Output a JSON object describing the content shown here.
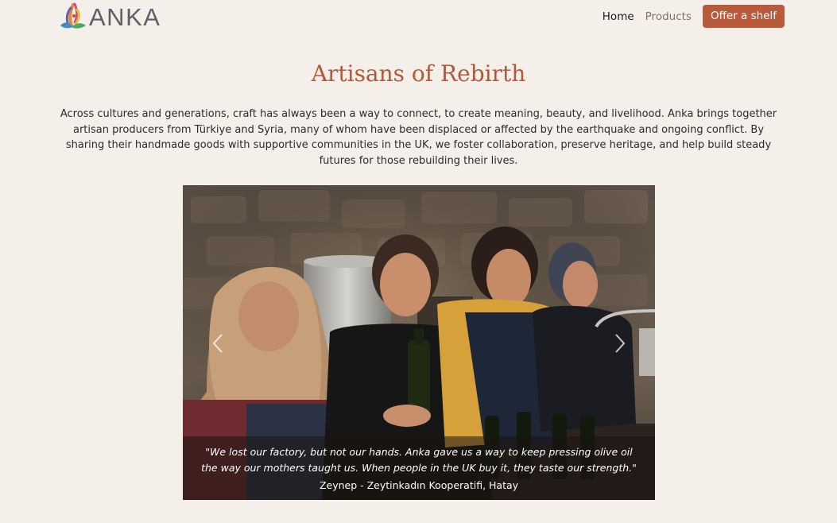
{
  "brand": {
    "name": "ANKA"
  },
  "nav": {
    "items": [
      {
        "label": "Home",
        "active": true
      },
      {
        "label": "Products",
        "active": false
      }
    ],
    "cta_label": "Offer a shelf",
    "cta_color": "#b95a3d"
  },
  "hero": {
    "title": "Artisans of Rebirth",
    "intro": "Across cultures and generations, craft has always been a way to connect, to create meaning, beauty, and livelihood. Anka brings together artisan producers from Türkiye and Syria, many of whom have been displaced or affected by the earthquake and ongoing conflict. By sharing their handmade goods with supportive communities in the UK, we foster collaboration, preserve heritage, and help build steady futures for those rebuilding their lives."
  },
  "carousel": {
    "quote": "\"We lost our factory, but not our hands. Anka gave us a way to keep pressing olive oil the way our mothers taught us. When people in the UK buy it, they taste our strength.\"",
    "attribution": "Zeynep - Zeytinkadın Kooperatifi, Hatay",
    "prev_icon": "chevron-left-icon",
    "next_icon": "chevron-right-icon"
  },
  "colors": {
    "background": "#f4efe8",
    "title": "#b4583b",
    "accent": "#b95a3d"
  }
}
